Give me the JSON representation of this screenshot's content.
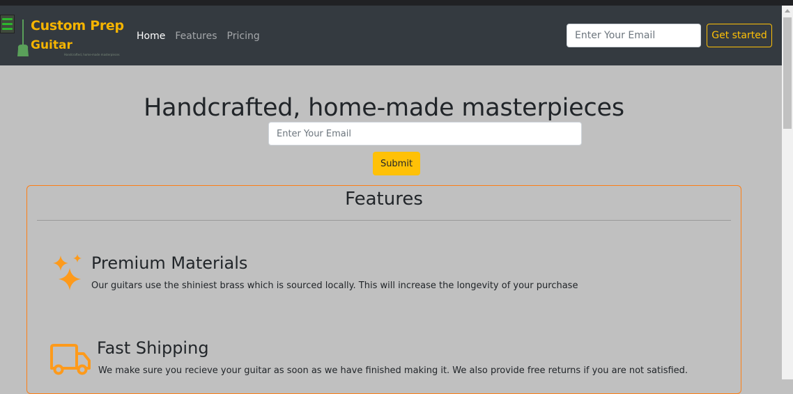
{
  "navbar": {
    "logo": {
      "line1": "Custom Prep",
      "line2": "Guitar",
      "tagline": "Handcrafted, home-made masterpieces"
    },
    "links": [
      {
        "label": "Home",
        "active": true
      },
      {
        "label": "Features",
        "active": false
      },
      {
        "label": "Pricing",
        "active": false
      }
    ],
    "email_placeholder": "Enter Your Email",
    "cta_label": "Get started"
  },
  "hero": {
    "title": "Handcrafted, home-made masterpieces",
    "email_placeholder": "Enter Your Email",
    "submit_label": "Submit"
  },
  "features": {
    "title": "Features",
    "items": [
      {
        "icon": "sparkles-icon",
        "title": "Premium Materials",
        "text": "Our guitars use the shiniest brass which is sourced locally. This will increase the longevity of your purchase"
      },
      {
        "icon": "truck-icon",
        "title": "Fast Shipping",
        "text": "We make sure you recieve your guitar as soon as we have finished making it. We also provide free returns if you are not satisfied."
      }
    ]
  },
  "colors": {
    "navbar": "#343a40",
    "accent_yellow": "#ffc107",
    "accent_orange": "#fd7e14",
    "page_bg": "#c0c0c0"
  }
}
